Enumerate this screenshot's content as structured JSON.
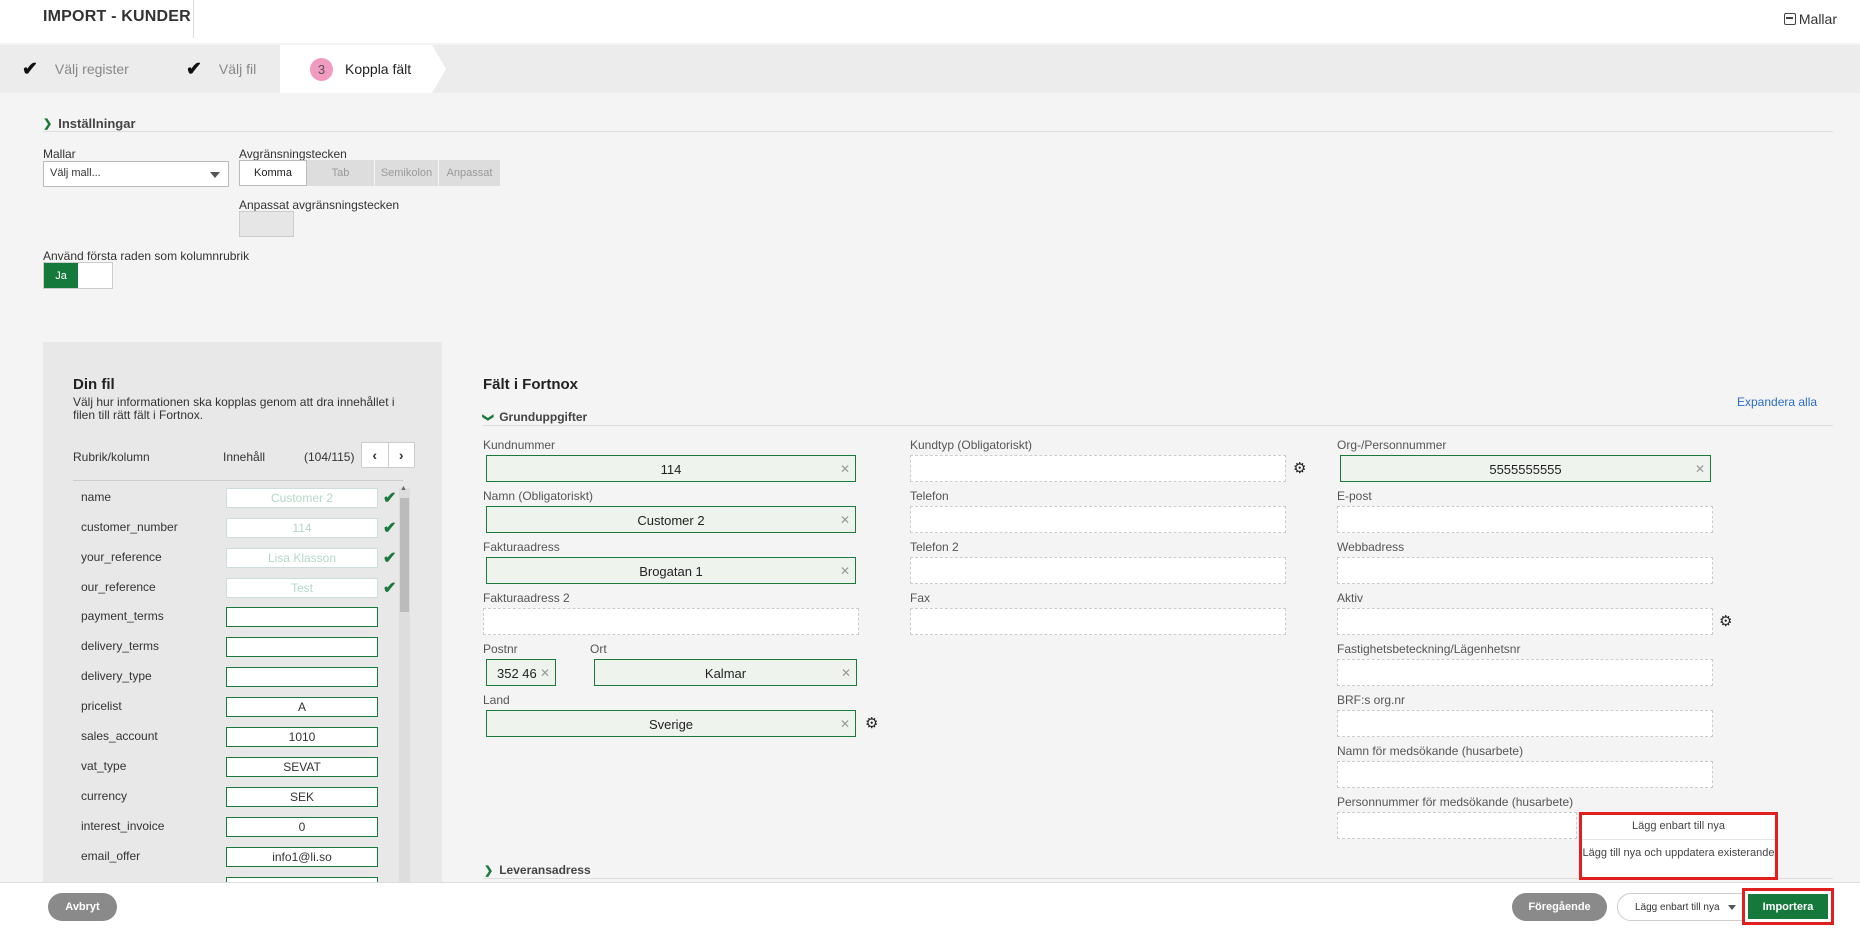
{
  "header": {
    "title": "IMPORT - KUNDER",
    "templates_label": "Mallar",
    "templates_icon": "template-icon"
  },
  "steps": [
    {
      "label": "Välj register",
      "state": "done",
      "icon": "check-icon"
    },
    {
      "label": "Välj fil",
      "state": "done",
      "icon": "check-icon"
    },
    {
      "number": "3",
      "label": "Koppla fält",
      "state": "active"
    }
  ],
  "settings": {
    "title": "Inställningar",
    "templates_label": "Mallar",
    "templates_placeholder": "Välj mall...",
    "delimiter_label": "Avgränsningstecken",
    "delimiters": [
      "Komma",
      "Tab",
      "Semikolon",
      "Anpassat"
    ],
    "selected_delimiter": "Komma",
    "custom_delimiter_label": "Anpassat avgränsningstecken",
    "first_row_header_label": "Använd första raden som kolumnrubrik",
    "first_row_header_value": "Ja"
  },
  "file_panel": {
    "title": "Din fil",
    "description": "Välj hur informationen ska kopplas genom att dra innehållet i filen till rätt fält i Fortnox.",
    "col_header": "Rubrik/kolumn",
    "content_header": "Innehåll",
    "counter": "(104/115)",
    "rows": [
      {
        "key": "name",
        "value": "Customer 2",
        "mapped": true
      },
      {
        "key": "customer_number",
        "value": "114",
        "mapped": true
      },
      {
        "key": "your_reference",
        "value": "Lisa Klasson",
        "mapped": true
      },
      {
        "key": "our_reference",
        "value": "Test",
        "mapped": true
      },
      {
        "key": "payment_terms",
        "value": "",
        "mapped": false
      },
      {
        "key": "delivery_terms",
        "value": "",
        "mapped": false
      },
      {
        "key": "delivery_type",
        "value": "",
        "mapped": false
      },
      {
        "key": "pricelist",
        "value": "A",
        "mapped": false
      },
      {
        "key": "sales_account",
        "value": "1010",
        "mapped": false
      },
      {
        "key": "vat_type",
        "value": "SEVAT",
        "mapped": false
      },
      {
        "key": "currency",
        "value": "SEK",
        "mapped": false
      },
      {
        "key": "interest_invoice",
        "value": "0",
        "mapped": false
      },
      {
        "key": "email_offer",
        "value": "info1@li.so",
        "mapped": false
      }
    ]
  },
  "fortnox": {
    "title": "Fält i Fortnox",
    "expand_all": "Expandera alla",
    "section1": "Grunduppgifter",
    "section2": "Leveransadress",
    "fields": {
      "kundnummer": {
        "label": "Kundnummer",
        "value": "114"
      },
      "namn": {
        "label": "Namn (Obligatoriskt)",
        "value": "Customer 2"
      },
      "fakturaadress": {
        "label": "Fakturaadress",
        "value": "Brogatan 1"
      },
      "fakturaadress2": {
        "label": "Fakturaadress 2",
        "value": ""
      },
      "postnr": {
        "label": "Postnr",
        "value": "352 46"
      },
      "ort": {
        "label": "Ort",
        "value": "Kalmar"
      },
      "land": {
        "label": "Land",
        "value": "Sverige"
      },
      "kundtyp": {
        "label": "Kundtyp (Obligatoriskt)",
        "value": ""
      },
      "telefon": {
        "label": "Telefon",
        "value": ""
      },
      "telefon2": {
        "label": "Telefon 2",
        "value": ""
      },
      "fax": {
        "label": "Fax",
        "value": ""
      },
      "orgnr": {
        "label": "Org-/Personnummer",
        "value": "5555555555"
      },
      "epost": {
        "label": "E-post",
        "value": ""
      },
      "webb": {
        "label": "Webbadress",
        "value": ""
      },
      "aktiv": {
        "label": "Aktiv",
        "value": ""
      },
      "fastighet": {
        "label": "Fastighetsbeteckning/Lägenhetsnr",
        "value": ""
      },
      "brf": {
        "label": "BRF:s org.nr",
        "value": ""
      },
      "namn_med": {
        "label": "Namn för medsökande (husarbete)",
        "value": ""
      },
      "pnr_med": {
        "label": "Personnummer för medsökande (husarbete)",
        "value": ""
      }
    }
  },
  "import_mode": {
    "options": [
      "Lägg enbart till nya",
      "Lägg till nya och uppdatera existerande"
    ],
    "selected": "Lägg enbart till nya"
  },
  "footer": {
    "cancel": "Avbryt",
    "previous": "Föregående",
    "import": "Importera"
  },
  "colors": {
    "accent_green": "#15793b",
    "highlight_red": "#e02020",
    "step_badge": "#f29bc1"
  }
}
